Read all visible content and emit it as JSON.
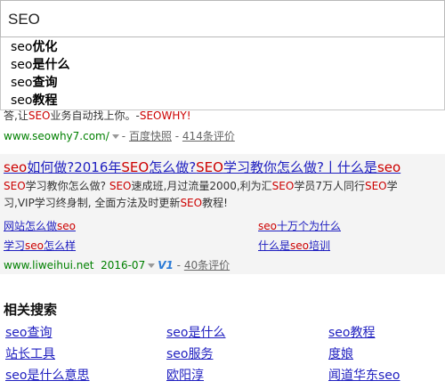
{
  "search": {
    "value": "SEO"
  },
  "suggestions": [
    {
      "base": "seo",
      "rest": "优化"
    },
    {
      "base": "seo",
      "rest": "是什么"
    },
    {
      "base": "seo",
      "rest": "查询"
    },
    {
      "base": "seo",
      "rest": "教程"
    }
  ],
  "result1": {
    "snippet_pre": "答,让",
    "snippet_em": "SEO",
    "snippet_mid": "业务自动找上你。-",
    "snippet_em2": "SEO",
    "snippet_post": "WHY!",
    "url": "www.seowhy7.com/",
    "snapshot": "百度快照",
    "reviews": "414条评价"
  },
  "result2": {
    "title": [
      {
        "t": "seo",
        "em": true
      },
      {
        "t": "如何做?2016年",
        "em": false
      },
      {
        "t": "SEO",
        "em": true
      },
      {
        "t": "怎么做?",
        "em": false
      },
      {
        "t": "SEO",
        "em": true
      },
      {
        "t": "学习教你怎么做?丨什么是",
        "em": false
      },
      {
        "t": "seo",
        "em": true
      }
    ],
    "line1": [
      {
        "t": "SEO",
        "em": true
      },
      {
        "t": "学习教你怎么做? ",
        "em": false
      },
      {
        "t": "SEO",
        "em": true
      },
      {
        "t": "速成班,月过流量2000,利为汇",
        "em": false
      },
      {
        "t": "SEO",
        "em": true
      },
      {
        "t": "学员7万人同行",
        "em": false
      },
      {
        "t": "SEO",
        "em": true
      },
      {
        "t": "学",
        "em": false
      }
    ],
    "line2": [
      {
        "t": "习,VIP学习终身制, 全面方法及时更新",
        "em": false
      },
      {
        "t": "SEO",
        "em": true
      },
      {
        "t": "教程!",
        "em": false
      }
    ],
    "links": [
      [
        {
          "t": "网站怎么做",
          "em": false
        },
        {
          "t": "seo",
          "em": true
        }
      ],
      [
        {
          "t": "seo",
          "em": true
        },
        {
          "t": "十万个为什么",
          "em": false
        }
      ],
      [
        {
          "t": "学习",
          "em": false
        },
        {
          "t": "seo",
          "em": true
        },
        {
          "t": "怎么样",
          "em": false
        }
      ],
      [
        {
          "t": "什么是",
          "em": false
        },
        {
          "t": "seo",
          "em": true
        },
        {
          "t": "培训",
          "em": false
        }
      ]
    ],
    "url": "www.liweihui.net",
    "date": "2016-07",
    "v_badge": "V1",
    "reviews": "40条评价"
  },
  "related": {
    "title": "相关搜索",
    "items": [
      "seo查询",
      "seo是什么",
      "seo教程",
      "站长工具",
      "seo服务",
      "度娘",
      "seo是什么意思",
      "欧阳淳",
      "闻道华东seo"
    ]
  }
}
